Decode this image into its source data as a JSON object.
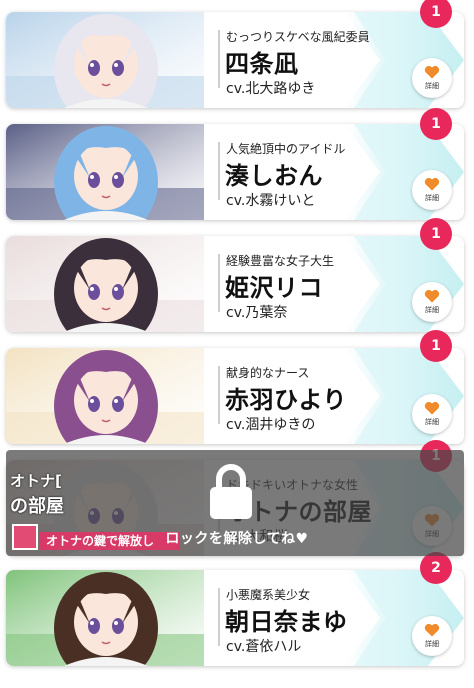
{
  "characters": [
    {
      "subtitle": "むっつりスケベな風紀委員",
      "name": "四条凪",
      "cv": "cv.北大路ゆき",
      "badge": "1",
      "detail_label": "詳細",
      "hair_color": "#e8e6ee",
      "bg_color": "#b9d3ea"
    },
    {
      "subtitle": "人気絶頂中のアイドル",
      "name": "湊しおん",
      "cv": "cv.水霧けいと",
      "badge": "1",
      "detail_label": "詳細",
      "hair_color": "#7fb4e6",
      "bg_color": "#5a5f86"
    },
    {
      "subtitle": "経験豊富な女子大生",
      "name": "姫沢リコ",
      "cv": "cv.乃葉奈",
      "badge": "1",
      "detail_label": "詳細",
      "hair_color": "#3a2f3b",
      "bg_color": "#e9dcdc"
    },
    {
      "subtitle": "献身的なナース",
      "name": "赤羽ひより",
      "cv": "cv.涸井ゆきの",
      "badge": "1",
      "detail_label": "詳細",
      "hair_color": "#8a4f8e",
      "bg_color": "#f3e2c2"
    },
    {
      "subtitle": "ドキドキいオトナな女性",
      "name": "オトナの部屋",
      "cv": "cv.大和桜",
      "badge": "1",
      "detail_label": "詳細",
      "hair_color": "#dcdcdc",
      "bg_color": "#d9c7c1",
      "locked": true
    },
    {
      "subtitle": "小悪魔系美少女",
      "name": "朝日奈まゆ",
      "cv": "cv.蒼依ハル",
      "badge": "2",
      "detail_label": "詳細",
      "hair_color": "#4a2f24",
      "bg_color": "#7fc37a"
    }
  ],
  "lock": {
    "message": "ロックを解除してね♥",
    "art_title_line1": "オトナ[",
    "art_title_line2": "の部屋",
    "art_banner": "オトナの鍵で解放し"
  },
  "colors": {
    "badge": "#e8285a",
    "heart": "#f08a2a",
    "accent_wedge": "#c6eff2"
  },
  "icons": {
    "detail": "heart-icon",
    "lock": "padlock-icon"
  }
}
